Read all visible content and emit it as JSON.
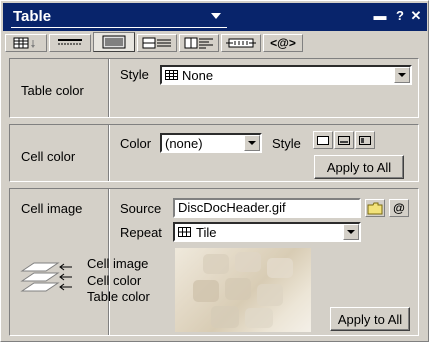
{
  "window": {
    "title": "Table",
    "controls": [
      "▬",
      "?",
      "✕"
    ]
  },
  "table_color": {
    "section_label": "Table color",
    "style_label": "Style",
    "style_value": "None"
  },
  "cell_color": {
    "section_label": "Cell color",
    "color_label": "Color",
    "color_value": "(none)",
    "style_label": "Style",
    "apply_label": "Apply to All"
  },
  "cell_image": {
    "section_label": "Cell image",
    "source_label": "Source",
    "source_value": "DiscDocHeader.gif",
    "repeat_label": "Repeat",
    "repeat_value": "Tile",
    "legend": [
      "Cell image",
      "Cell color",
      "Table color"
    ],
    "apply_label": "Apply to All"
  },
  "colors": {
    "titlebar": "#08246b",
    "panel": "#d4d0c8"
  }
}
